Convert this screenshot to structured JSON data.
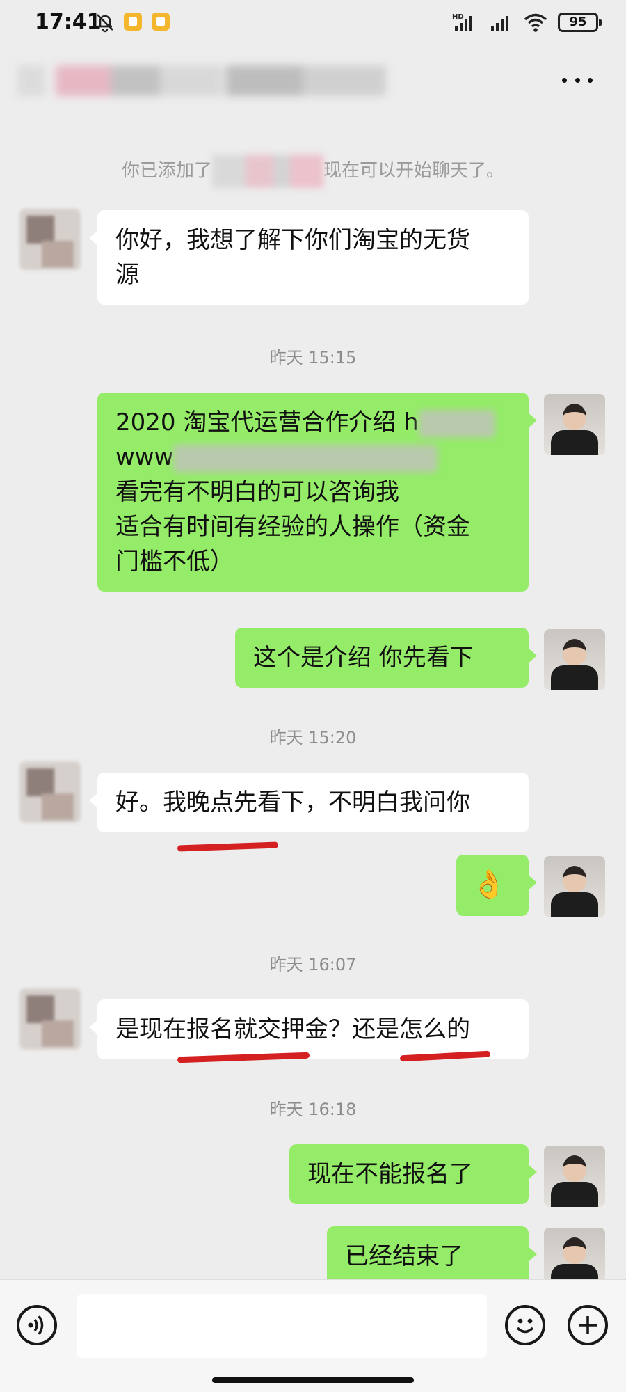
{
  "status_bar": {
    "time": "17:41",
    "network": "HD",
    "battery": "95",
    "icons": [
      "bell-off-icon",
      "notification-app-icon",
      "notification-app-icon",
      "signal-icon",
      "signal-icon",
      "wifi-icon",
      "battery-icon"
    ]
  },
  "header": {
    "more_icon": "more-horizontal-icon"
  },
  "chat": {
    "system_notice": {
      "prefix": "你已添加了",
      "suffix": "现在可以开始聊天了。"
    },
    "msg1": {
      "lines": [
        "你好，我想了解下你们淘宝的无货",
        "源"
      ]
    },
    "time1": "昨天 15:15",
    "msg2": {
      "line1": "2020 淘宝代运营合作介绍 h",
      "line2": "www",
      "line3": "看完有不明白的可以咨询我",
      "line4": "适合有时间有经验的人操作（资金",
      "line5": "门槛不低）"
    },
    "msg3": "这个是介绍  你先看下",
    "time2": "昨天 15:20",
    "msg4": "好。我晚点先看下，不明白我问你",
    "msg5": "👌",
    "time3": "昨天 16:07",
    "msg6": "是现在报名就交押金？还是怎么的",
    "time4": "昨天 16:18",
    "msg7": "现在不能报名了",
    "msg8": "已经结束了"
  },
  "input_bar": {
    "icons": [
      "voice-icon",
      "emoji-icon",
      "plus-icon"
    ]
  },
  "colors": {
    "background": "#ededed",
    "bubble_green": "#95ec69",
    "bubble_white": "#ffffff",
    "underline_red": "#d42020"
  }
}
